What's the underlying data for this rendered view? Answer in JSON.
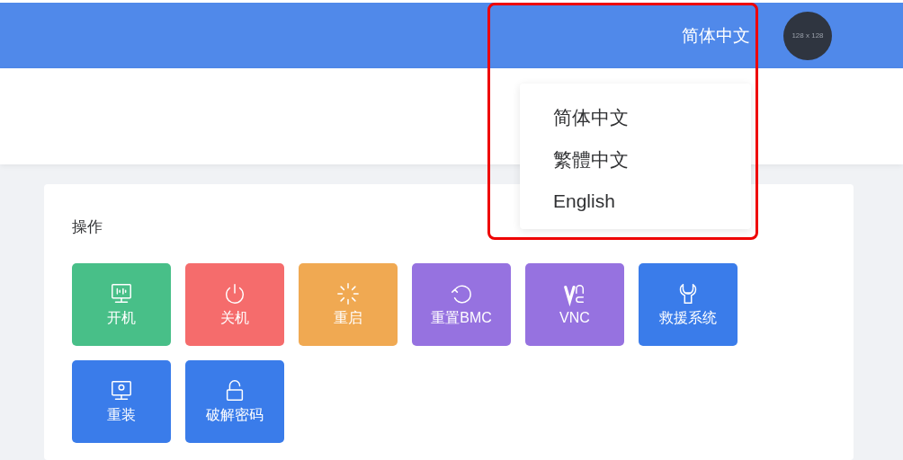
{
  "header": {
    "language": "简体中文",
    "avatar_text": "128 x 128"
  },
  "language_menu": {
    "items": [
      {
        "label": "简体中文"
      },
      {
        "label": "繁體中文"
      },
      {
        "label": "English"
      }
    ]
  },
  "operations": {
    "title": "操作",
    "buttons": [
      {
        "label": "开机",
        "color": "#48bf88",
        "kind": "monitor"
      },
      {
        "label": "关机",
        "color": "#f56c6c",
        "kind": "power"
      },
      {
        "label": "重启",
        "color": "#f0a952",
        "kind": "spinner"
      },
      {
        "label": "重置BMC",
        "color": "#9672e0",
        "kind": "reset"
      },
      {
        "label": "VNC",
        "color": "#9672e0",
        "kind": "vnc"
      },
      {
        "label": "救援系统",
        "color": "#3a7cea",
        "kind": "wrench"
      },
      {
        "label": "重装",
        "color": "#3a7cea",
        "kind": "install"
      },
      {
        "label": "破解密码",
        "color": "#3a7cea",
        "kind": "unlock"
      }
    ]
  }
}
